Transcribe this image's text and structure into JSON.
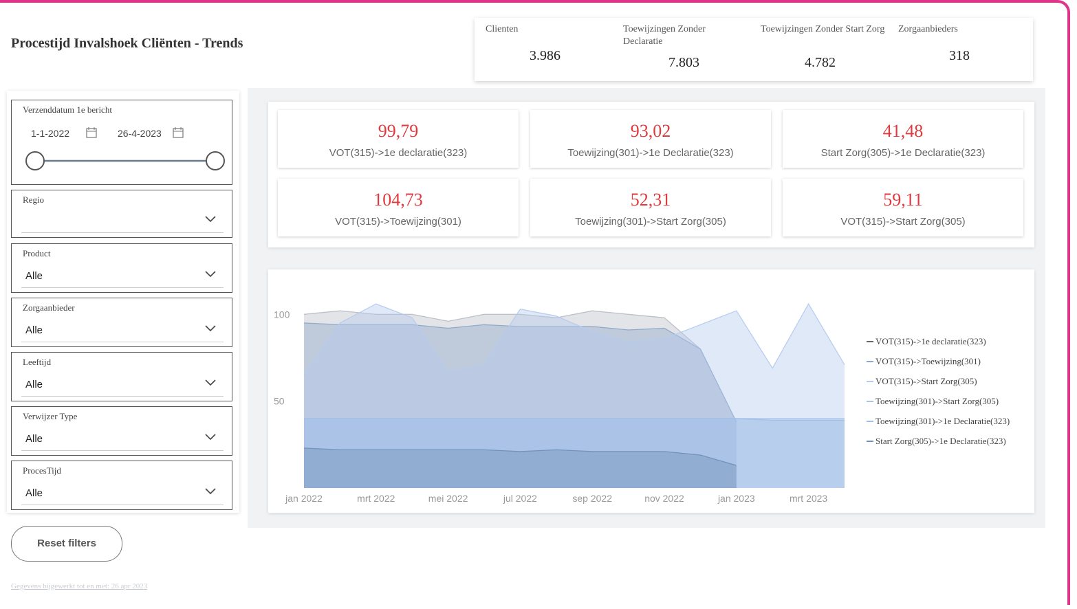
{
  "title": "Procestijd Invalshoek Cliënten - Trends",
  "top_kpis": [
    {
      "label": "Clienten",
      "value": "3.986"
    },
    {
      "label": "Toewijzingen Zonder Declaratie",
      "value": "7.803"
    },
    {
      "label": "Toewijzingen Zonder Start Zorg",
      "value": "4.782"
    },
    {
      "label": "Zorgaanbieders",
      "value": "318"
    }
  ],
  "date_slicer": {
    "label": "Verzenddatum 1e bericht",
    "from": "1-1-2022",
    "to": "26-4-2023"
  },
  "slicers": [
    {
      "label": "Regio",
      "value": ""
    },
    {
      "label": "Product",
      "value": "Alle"
    },
    {
      "label": "Zorgaanbieder",
      "value": "Alle"
    },
    {
      "label": "Leeftijd",
      "value": "Alle"
    },
    {
      "label": "Verwijzer Type",
      "value": "Alle"
    },
    {
      "label": "ProcesTijd",
      "value": "Alle"
    }
  ],
  "reset_label": "Reset filters",
  "footnote": "Gegevens bijgewerkt tot en met: 26 apr 2023",
  "metrics": [
    {
      "value": "99,79",
      "caption": "VOT(315)->1e declaratie(323)"
    },
    {
      "value": "93,02",
      "caption": "Toewijzing(301)->1e Declaratie(323)"
    },
    {
      "value": "41,48",
      "caption": "Start Zorg(305)->1e Declaratie(323)"
    },
    {
      "value": "104,73",
      "caption": "VOT(315)->Toewijzing(301)"
    },
    {
      "value": "52,31",
      "caption": "Toewijzing(301)->Start Zorg(305)"
    },
    {
      "value": "59,11",
      "caption": "VOT(315)->Start Zorg(305)"
    }
  ],
  "colors": {
    "accent_border": "#e0338a",
    "metric_red": "#e0393e"
  },
  "chart_data": {
    "type": "area",
    "x": [
      "jan 2022",
      "feb 2022",
      "mrt 2022",
      "apr 2022",
      "mei 2022",
      "jun 2022",
      "jul 2022",
      "aug 2022",
      "sep 2022",
      "okt 2022",
      "nov 2022",
      "dec 2022",
      "jan 2023",
      "feb 2023",
      "mrt 2023",
      "apr 2023"
    ],
    "x_tick_labels": [
      "jan 2022",
      "mrt 2022",
      "mei 2022",
      "jul 2022",
      "sep 2022",
      "nov 2022",
      "jan 2023",
      "mrt 2023"
    ],
    "y_ticks": [
      50,
      100
    ],
    "ylim": [
      0,
      110
    ],
    "legend_position": "right",
    "series": [
      {
        "name": "VOT(315)->1e declaratie(323)",
        "color": "#b9bec6",
        "values": [
          100,
          102,
          100,
          100,
          96,
          100,
          100,
          98,
          102,
          100,
          98,
          80,
          38,
          null,
          null,
          null
        ]
      },
      {
        "name": "VOT(315)->Toewijzing(301)",
        "color": "#8ea7c7",
        "values": [
          95,
          94,
          94,
          94,
          92,
          94,
          93,
          93,
          93,
          91,
          92,
          80,
          38,
          null,
          null,
          null
        ]
      },
      {
        "name": "VOT(315)->Start Zorg(305)",
        "color": "#b5cbee",
        "values": [
          65,
          95,
          106,
          98,
          67,
          71,
          103,
          99,
          90,
          84,
          86,
          94,
          102,
          69,
          106,
          71
        ]
      },
      {
        "name": "Toewijzing(301)->Start Zorg(305)",
        "color": "#a9c4ea",
        "values": [
          40,
          40,
          40,
          40,
          40,
          40,
          40,
          40,
          40,
          40,
          40,
          40,
          40,
          40,
          40,
          40
        ]
      },
      {
        "name": "Toewijzing(301)->1e Declaratie(323)",
        "color": "#9fbfe8",
        "values": [
          40,
          40,
          40,
          40,
          40,
          40,
          40,
          40,
          40,
          40,
          40,
          40,
          40,
          39,
          39,
          39
        ]
      },
      {
        "name": "Start Zorg(305)->1e Declaratie(323)",
        "color": "#6f8fb8",
        "values": [
          23,
          22,
          22,
          22,
          22,
          22,
          21,
          22,
          21,
          21,
          21,
          19,
          13,
          null,
          null,
          null
        ]
      }
    ]
  }
}
